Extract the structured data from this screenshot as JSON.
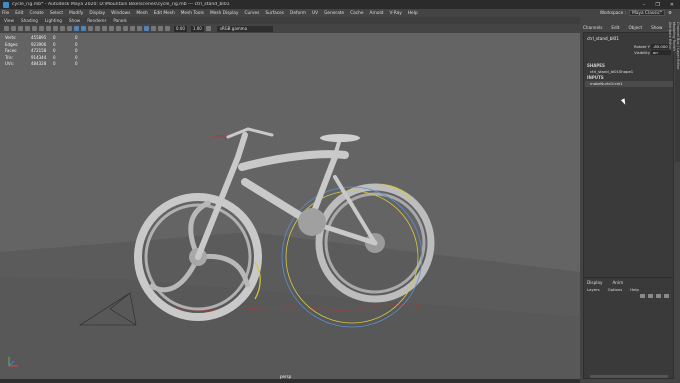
{
  "window": {
    "title": "cycle_rig.mb* - Autodesk Maya 2020: D:\\Mountain Bike\\scenes\\cycle_rig.mb  ---  ctrl_stand_bl01",
    "controls": [
      "–",
      "❐",
      "✕"
    ]
  },
  "menubar": {
    "items": [
      "File",
      "Edit",
      "Create",
      "Select",
      "Modify",
      "Display",
      "Windows",
      "Mesh",
      "Edit Mesh",
      "Mesh Tools",
      "Mesh Display",
      "Curves",
      "Surfaces",
      "Deform",
      "UV",
      "Generate",
      "Cache",
      "Arnold",
      "V-Ray",
      "Help"
    ],
    "workspace_label": "Workspace :",
    "workspace_value": "Maya Classic*"
  },
  "panel": {
    "menus": [
      "View",
      "Shading",
      "Lighting",
      "Show",
      "Renderer",
      "Panels"
    ],
    "field1": "0.00",
    "field2": "1.00",
    "color_space": "sRGB gamma",
    "camera": "persp"
  },
  "hud": [
    {
      "label": "Verts:",
      "a": "455895",
      "b": "0",
      "c": "0"
    },
    {
      "label": "Edges:",
      "a": "923906",
      "b": "0",
      "c": "0"
    },
    {
      "label": "Faces:",
      "a": "472158",
      "b": "0",
      "c": "0"
    },
    {
      "label": "Tris:",
      "a": "914344",
      "b": "0",
      "c": "0"
    },
    {
      "label": "UVs:",
      "a": "484328",
      "b": "0",
      "c": "0"
    }
  ],
  "channel_box": {
    "tabs": [
      "Channels",
      "Edit",
      "Object",
      "Show"
    ],
    "object": "ctrl_stand_bl01",
    "attributes": [
      {
        "name": "Rotate Y",
        "value": "-85.000"
      },
      {
        "name": "Visibility",
        "value": "on"
      }
    ],
    "shapes_header": "SHAPES",
    "shape_item": "ctrl_stand_bl01Shape1",
    "inputs_header": "INPUTS",
    "input_item": "makeNurbCircle1"
  },
  "side_tabs": [
    "Channel Box / Layer Editor",
    "Modeling Toolkit",
    "Attribute Editor"
  ],
  "layer_editor": {
    "tabs": [
      "Display",
      "Anim"
    ],
    "menus": [
      "Layers",
      "Options",
      "Help"
    ]
  },
  "colors": {
    "viewport_bg": "#646464",
    "ground": "#595959",
    "bike": "#c9c9c9",
    "ctrl_yellow": "#d7c93c",
    "ctrl_blue": "#5b8fd6",
    "ctrl_red": "#b03a3a"
  }
}
